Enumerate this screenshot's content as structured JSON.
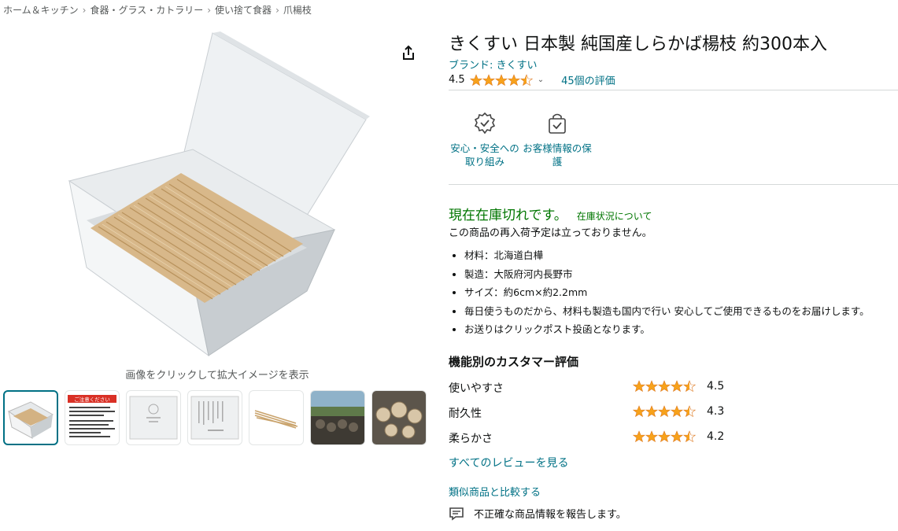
{
  "breadcrumb": [
    "ホーム＆キッチン",
    "食器・グラス・カトラリー",
    "使い捨て食器",
    "爪楊枝"
  ],
  "breadcrumb_sep": "›",
  "gallery": {
    "zoom_hint": "画像をクリックして拡大イメージを表示",
    "notice_thumb_header": "ご注意ください"
  },
  "product": {
    "title": "きくすい 日本製 純国産しらかば楊枝 約300本入",
    "brand": "ブランド: きくすい",
    "rating": "4.5",
    "rating_stars": 4.5,
    "rating_count": "45個の評価"
  },
  "badges": [
    {
      "label": "安心・安全への取り組み",
      "icon": "shield-check-icon"
    },
    {
      "label": "お客様情報の保護",
      "icon": "lock-bag-icon"
    }
  ],
  "stock": {
    "status": "現在在庫切れです。",
    "link": "在庫状況について",
    "restock": "この商品の再入荷予定は立っておりません。"
  },
  "bullets": [
    "材料：北海道白樺",
    "製造：大阪府河内長野市",
    "サイズ：約6cm×約2.2mm",
    "毎日使うものだから、材料も製造も国内で行い 安心してご使用できるものをお届けします。",
    "お送りはクリックポスト投函となります。"
  ],
  "features": {
    "title": "機能別のカスタマー評価",
    "items": [
      {
        "label": "使いやすさ",
        "value": "4.5",
        "stars": 4.5
      },
      {
        "label": "耐久性",
        "value": "4.3",
        "stars": 4.5
      },
      {
        "label": "柔らかさ",
        "value": "4.2",
        "stars": 4.5
      }
    ]
  },
  "links": {
    "all_reviews": "すべてのレビューを見る",
    "compare": "類似商品と比較する",
    "report": "不正確な商品情報を報告します。"
  },
  "colors": {
    "link": "#007185",
    "star": "#f7a21b",
    "stock": "#007600",
    "thumb_active": "#007185"
  }
}
